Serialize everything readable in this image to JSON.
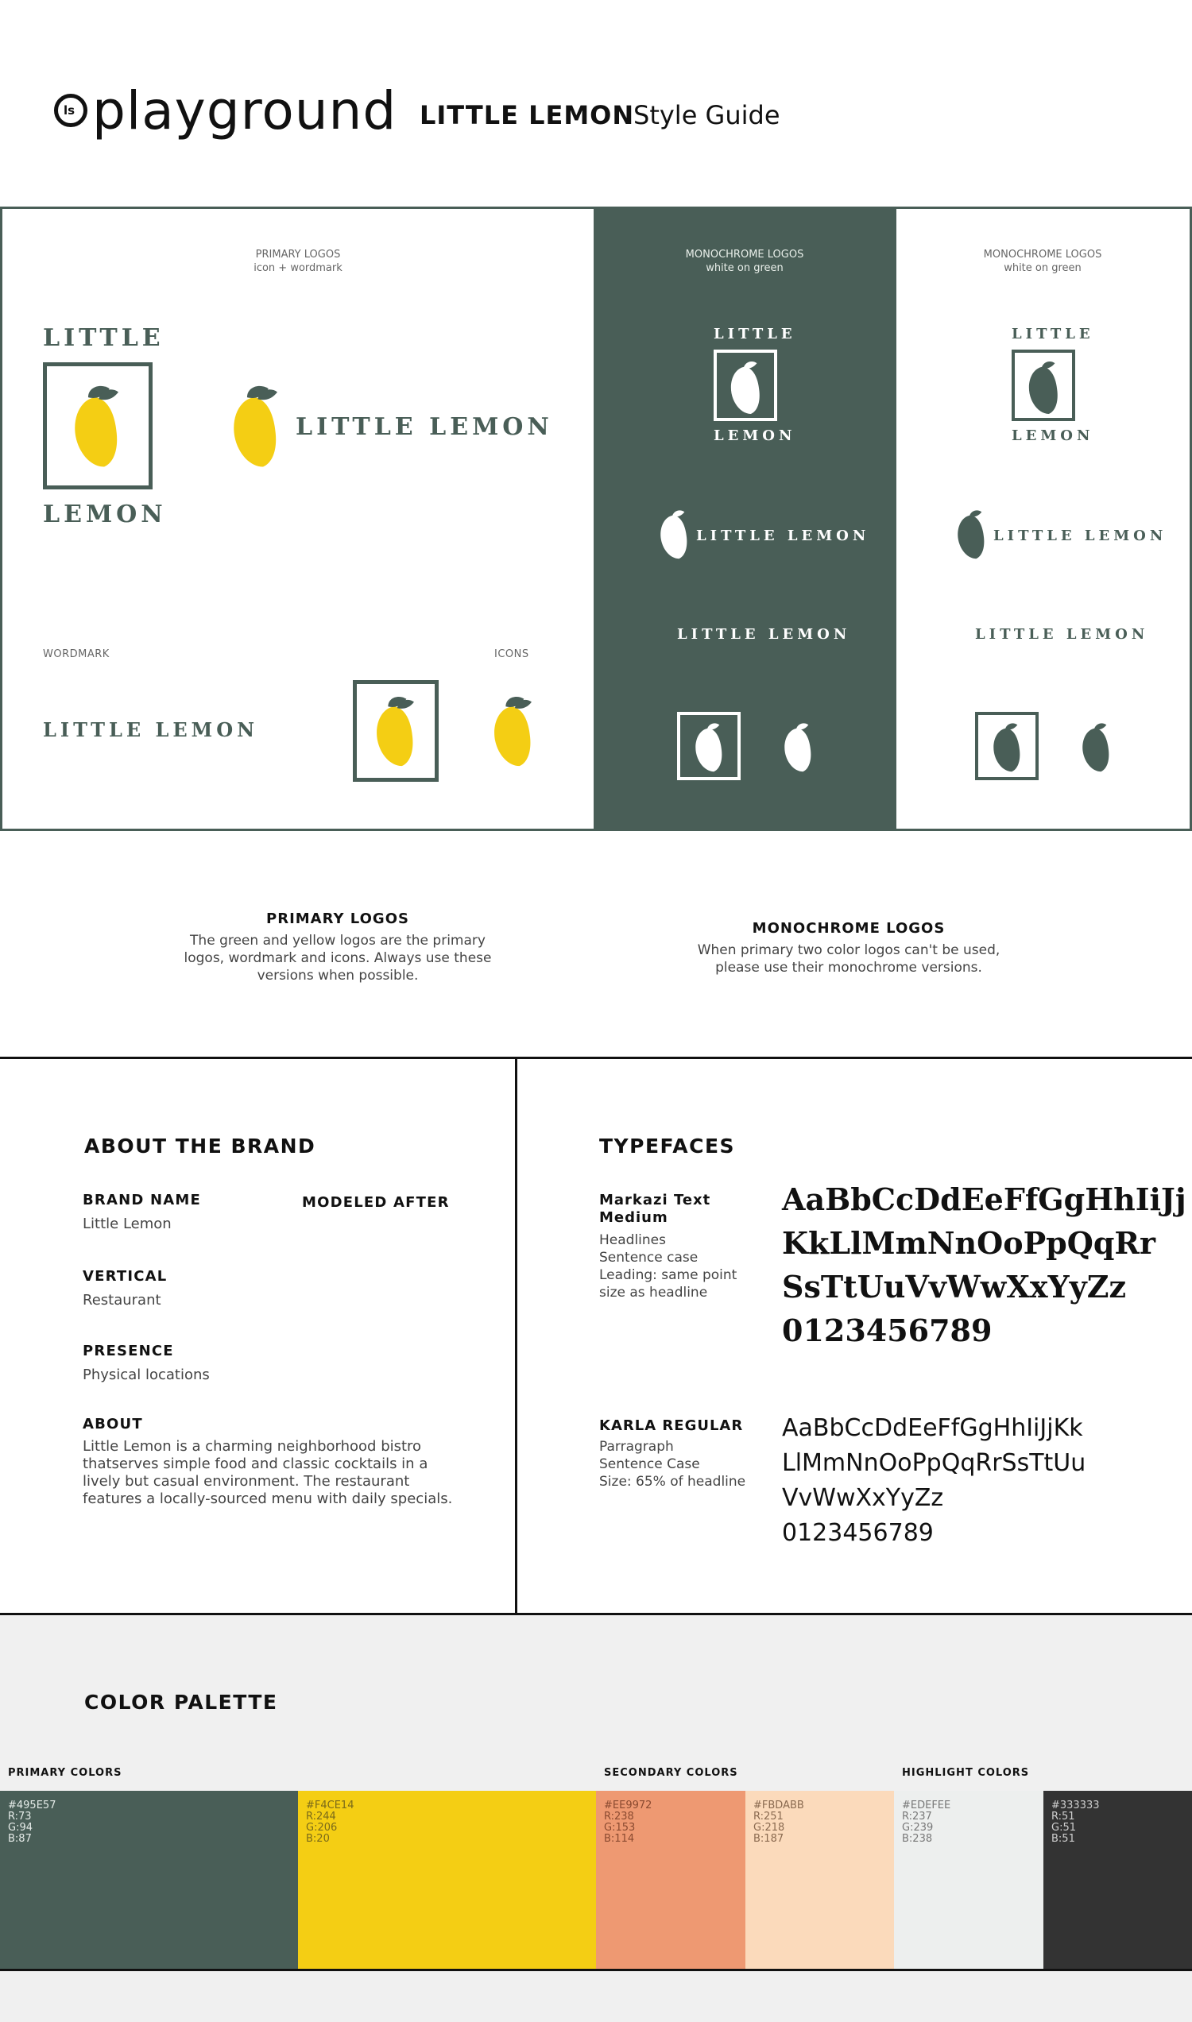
{
  "header": {
    "brand": "playground",
    "brand_mark": "ls",
    "title": "LITTLE LEMON",
    "subtitle": "Style Guide"
  },
  "logos": {
    "primary_caption_1": "PRIMARY LOGOS",
    "primary_caption_2": "icon + wordmark",
    "mono1_caption_1": "MONOCHROME LOGOS",
    "mono1_caption_2": "white on green",
    "mono2_caption_1": "MONOCHROME LOGOS",
    "mono2_caption_2": "white on green",
    "word_little": "LITTLE",
    "word_lemon": "LEMON",
    "word_full": "LITTLE LEMON",
    "wordmark_label": "WORDMARK",
    "icons_label": "ICONS"
  },
  "captions": {
    "primary_title": "PRIMARY LOGOS",
    "primary_l1": "The green and yellow logos are the primary",
    "primary_l2": "logos, wordmark and icons. Always use these",
    "primary_l3": "versions when possible.",
    "mono_title": "MONOCHROME LOGOS",
    "mono_l1": "When primary two color logos can't be used,",
    "mono_l2": "please use their monochrome versions."
  },
  "about": {
    "title": "ABOUT THE BRAND",
    "brand_name_label": "BRAND NAME",
    "brand_name": "Little Lemon",
    "modeled_label": "MODELED AFTER",
    "vertical_label": "VERTICAL",
    "vertical": "Restaurant",
    "presence_label": "PRESENCE",
    "presence": "Physical locations",
    "about_label": "ABOUT",
    "about_l1": "Little Lemon is a charming neighborhood bistro",
    "about_l2": "thatserves simple food and classic cocktails in a",
    "about_l3": "lively but casual environment. The restaurant",
    "about_l4": "features a locally-sourced menu with daily specials."
  },
  "typefaces": {
    "title": "TYPEFACES",
    "serif_name_1": "Markazi Text",
    "serif_name_2": "Medium",
    "serif_desc_1": "Headlines",
    "serif_desc_2": "Sentence case",
    "serif_desc_3": "Leading: same point",
    "serif_desc_4": "size as headline",
    "serif_sample_1": "AaBbCcDdEeFfGgHhIiJj",
    "serif_sample_2": "KkLlMmNnOoPpQqRr",
    "serif_sample_3": "SsTtUuVvWwXxYyZz",
    "serif_sample_4": "0123456789",
    "sans_name": "KARLA REGULAR",
    "sans_desc_1": "Parragraph",
    "sans_desc_2": "Sentence Case",
    "sans_desc_3": "Size: 65% of headline",
    "sans_sample_1": "AaBbCcDdEeFfGgHhIiJjKk",
    "sans_sample_2": "LlMmNnOoPpQqRrSsTtUu",
    "sans_sample_3": "VvWwXxYyZz",
    "sans_sample_4": "0123456789"
  },
  "palette": {
    "title": "COLOR PALETTE",
    "primary_label": "PRIMARY COLORS",
    "secondary_label": "SECONDARY COLORS",
    "highlight_label": "HIGHLIGHT COLORS",
    "swatches": [
      {
        "hex": "#495E57",
        "r": "R:73",
        "g": "G:94",
        "b": "B:87"
      },
      {
        "hex": "#F4CE14",
        "r": "R:244",
        "g": "G:206",
        "b": "B:20"
      },
      {
        "hex": "#EE9972",
        "r": "R:238",
        "g": "G:153",
        "b": "B:114"
      },
      {
        "hex": "#FBDABB",
        "r": "R:251",
        "g": "G:218",
        "b": "B:187"
      },
      {
        "hex": "#EDEFEE",
        "r": "R:237",
        "g": "G:239",
        "b": "B:238"
      },
      {
        "hex": "#333333",
        "r": "R:51",
        "g": "G:51",
        "b": "B:51"
      }
    ]
  },
  "colors": {
    "green": "#495E57",
    "yellow": "#F4CE14",
    "salmon": "#EE9972",
    "peach": "#FBDABB",
    "light": "#EDEFEE",
    "dark": "#333333"
  }
}
